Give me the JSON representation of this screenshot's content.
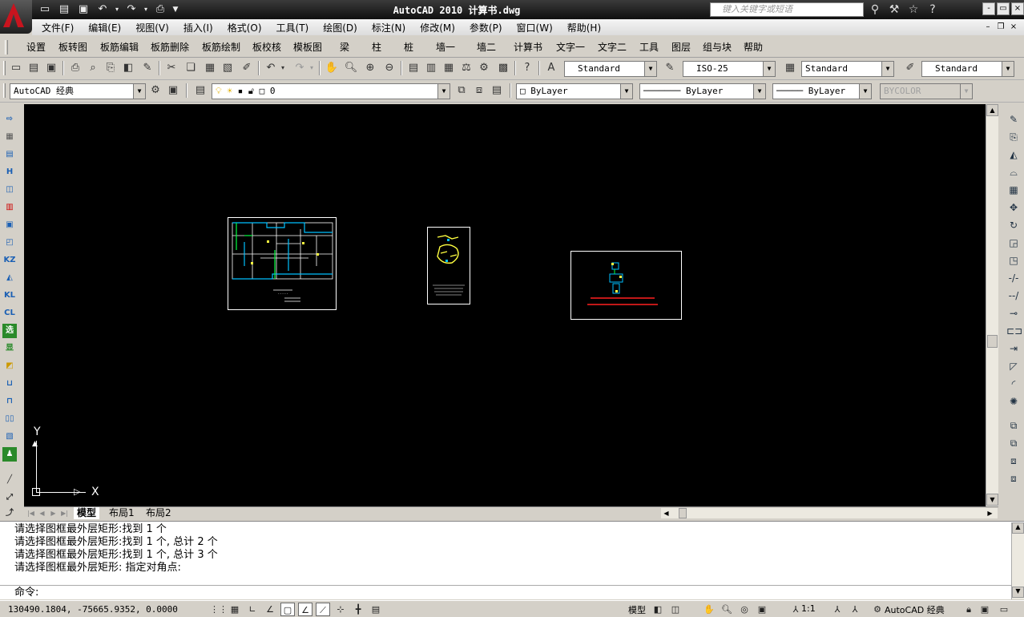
{
  "titlebar": {
    "title": "AutoCAD 2010   计算书.dwg",
    "search_placeholder": "键入关键字或短语",
    "window_controls": [
      "-",
      "▭",
      "×"
    ]
  },
  "menubar": {
    "items": [
      "文件(F)",
      "编辑(E)",
      "视图(V)",
      "插入(I)",
      "格式(O)",
      "工具(T)",
      "绘图(D)",
      "标注(N)",
      "修改(M)",
      "参数(P)",
      "窗口(W)",
      "帮助(H)"
    ]
  },
  "plugin_menu": {
    "items": [
      "设置",
      "板转图",
      "板筋编辑",
      "板筋删除",
      "板筋绘制",
      "板校核",
      "模板图",
      "梁",
      "柱",
      "桩",
      "墙一",
      "墙二",
      "计算书",
      "文字一",
      "文字二",
      "工具",
      "图层",
      "组与块",
      "帮助"
    ]
  },
  "styles_toolbar": {
    "text_style": "Standard",
    "dim_style": "ISO-25",
    "table_style": "Standard",
    "mleader_style": "Standard"
  },
  "workspace": {
    "name": "AutoCAD 经典"
  },
  "layers": {
    "current_layer": "0"
  },
  "properties": {
    "color": "ByLayer",
    "linetype": "ByLayer",
    "lineweight": "ByLayer",
    "plot_style": "BYCOLOR"
  },
  "drawing": {
    "ucs_y": "Y",
    "ucs_x": "X",
    "background": "#000000"
  },
  "layout_tabs": [
    "模型",
    "布局1",
    "布局2"
  ],
  "command": {
    "history": [
      "请选择图框最外层矩形:找到 1 个",
      "请选择图框最外层矩形:找到 1 个, 总计 2 个",
      "请选择图框最外层矩形:找到 1 个, 总计 3 个",
      "请选择图框最外层矩形: 指定对角点:"
    ],
    "prompt": "命令:"
  },
  "status": {
    "coordinates": "130490.1804, -75665.9352, 0.0000",
    "model_label": "模型",
    "annotation_scale": "1:1",
    "workspace": "AutoCAD 经典"
  }
}
